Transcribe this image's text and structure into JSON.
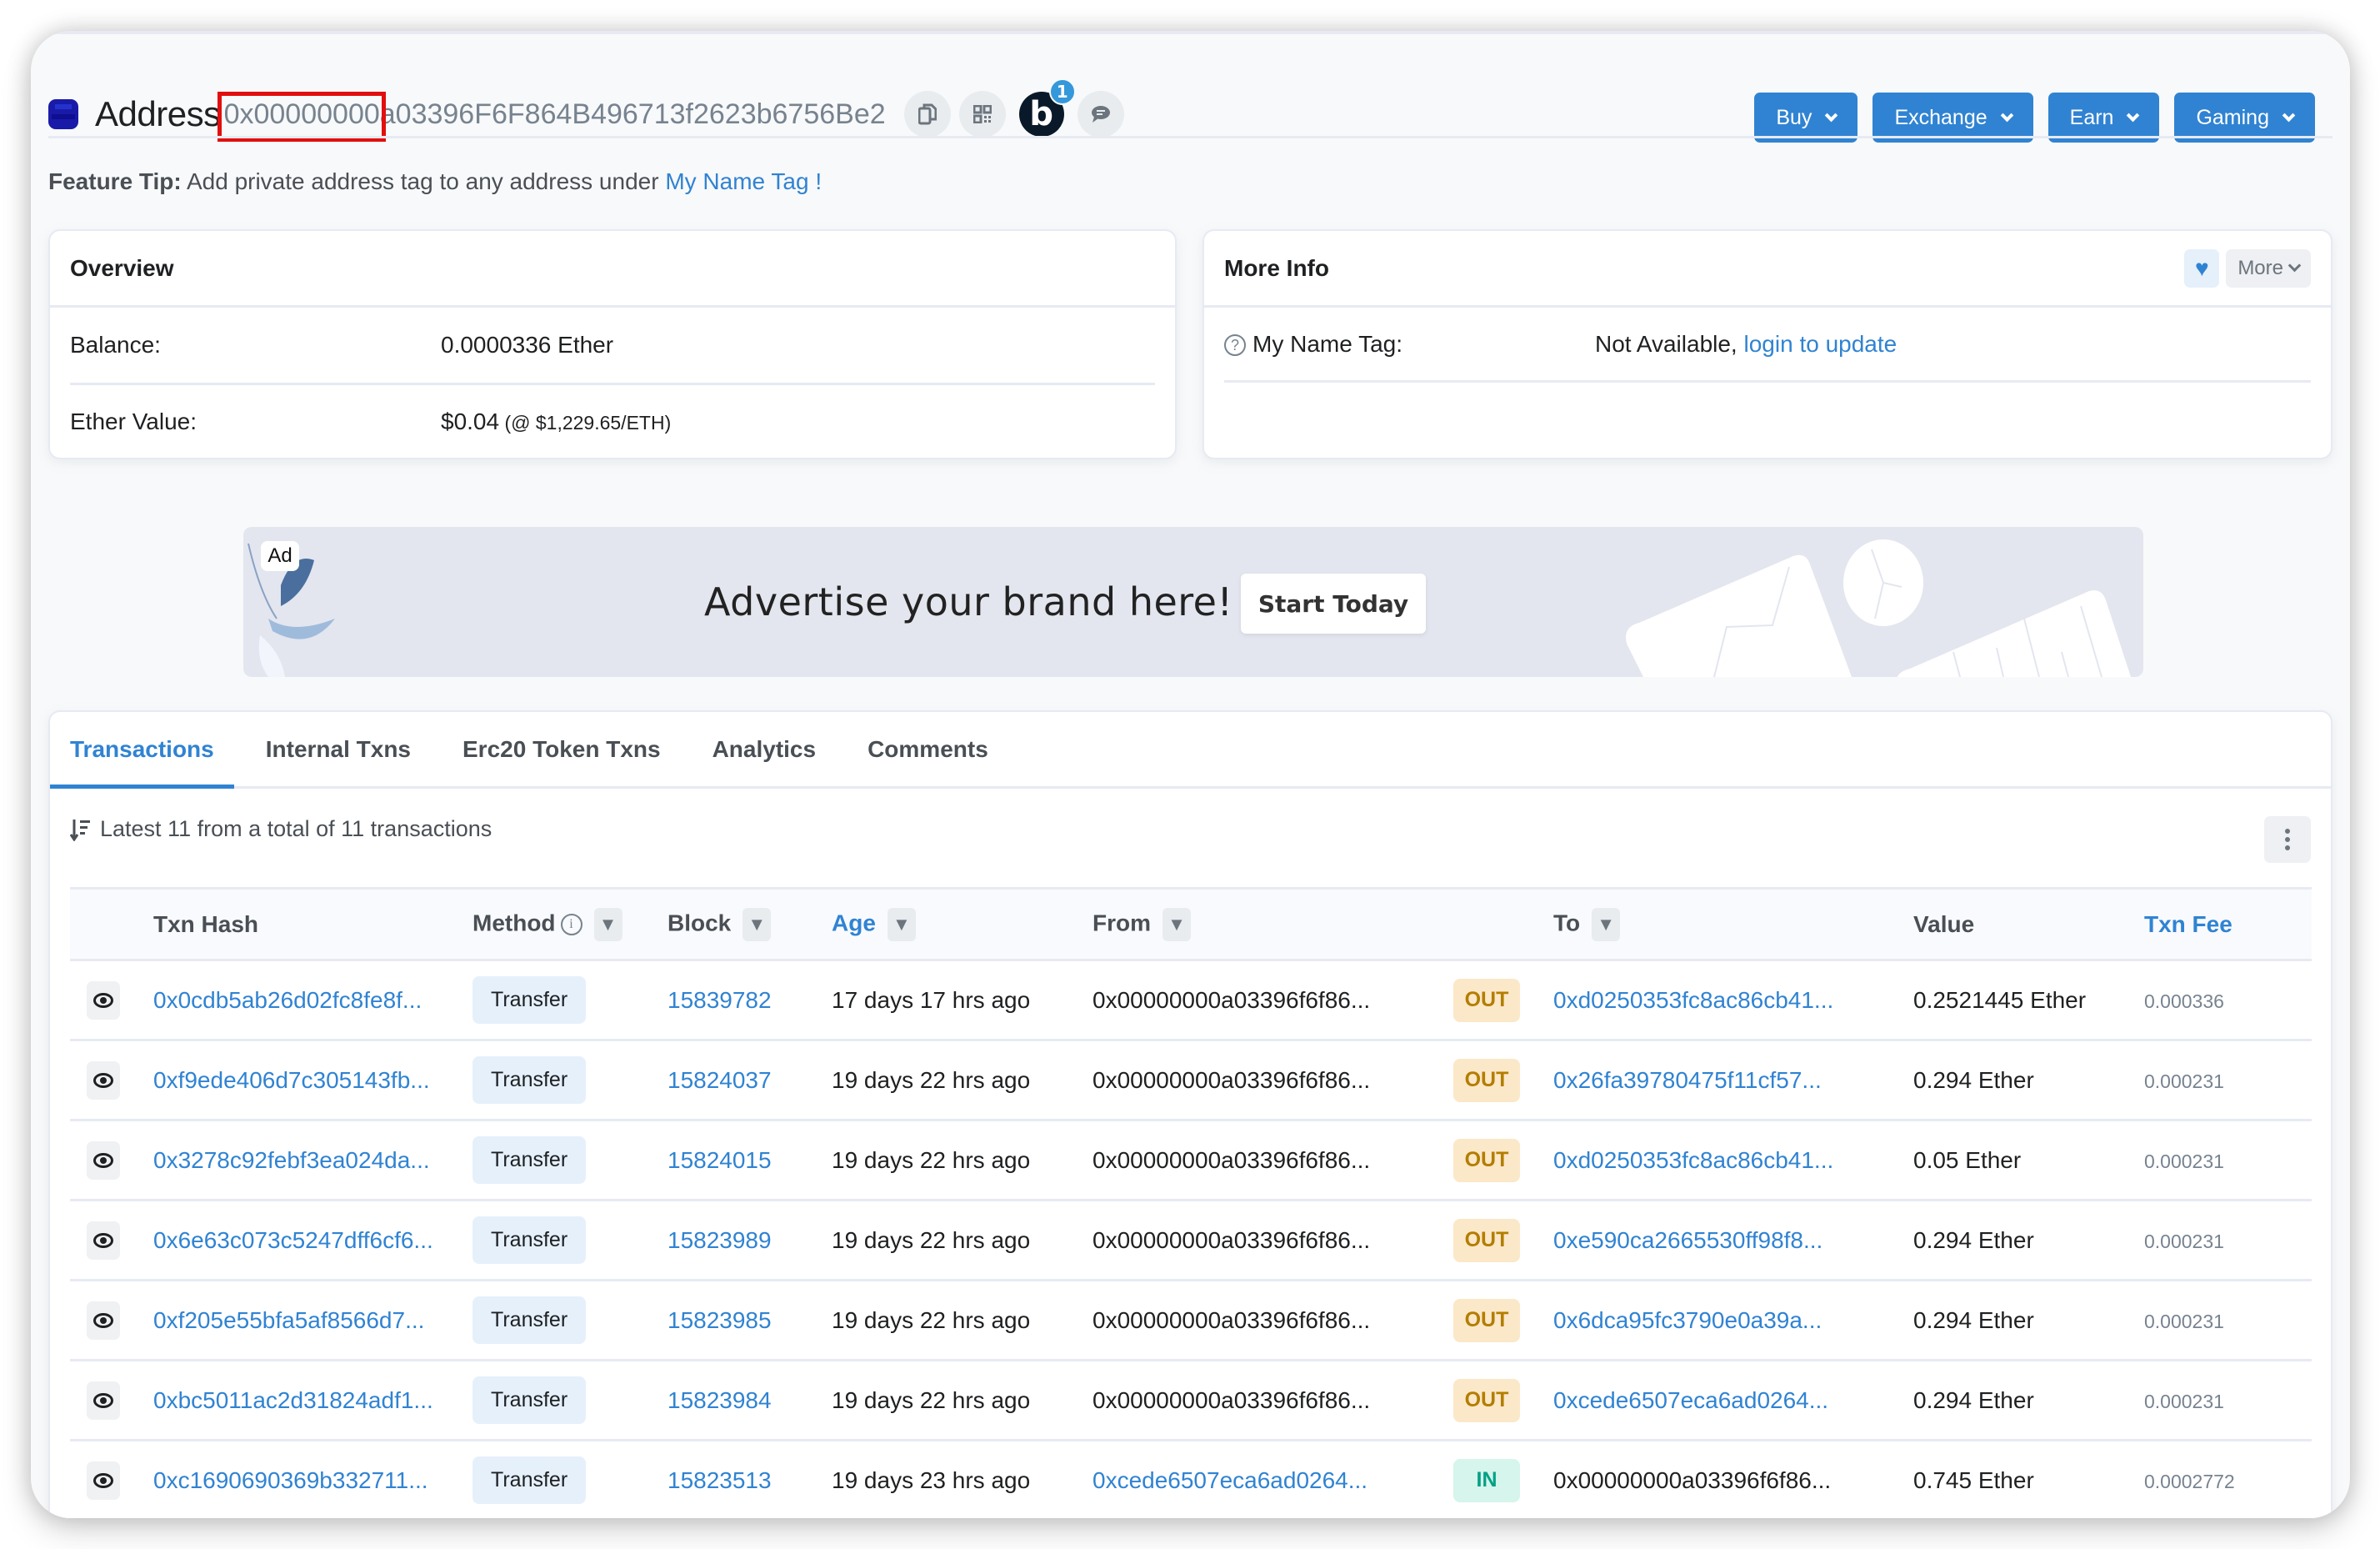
{
  "header": {
    "label": "Address",
    "address": "0x00000000a03396F6F864B496713f2623b6756Be2",
    "notification_count": "1",
    "b_label": "b",
    "nav_buttons": [
      "Buy",
      "Exchange",
      "Earn",
      "Gaming"
    ]
  },
  "feature_tip": {
    "prefix": "Feature Tip:",
    "text": " Add private address tag to any address under ",
    "link": "My Name Tag !"
  },
  "overview": {
    "title": "Overview",
    "balance_label": "Balance:",
    "balance_value": "0.0000336 Ether",
    "ether_value_label": "Ether Value:",
    "ether_value": "$0.04",
    "ether_price": " (@ $1,229.65/ETH)"
  },
  "more_info": {
    "title": "More Info",
    "more_label": "More",
    "name_tag_label": "My Name Tag:",
    "name_tag_value": "Not Available, ",
    "name_tag_link": "login to update"
  },
  "ad": {
    "tag": "Ad",
    "headline": "Advertise your brand here!",
    "cta": "Start Today"
  },
  "tabs": [
    "Transactions",
    "Internal Txns",
    "Erc20 Token Txns",
    "Analytics",
    "Comments"
  ],
  "active_tab": "Transactions",
  "summary": "Latest 11 from a total of 11 transactions",
  "table": {
    "headers": {
      "txn_hash": "Txn Hash",
      "method": "Method",
      "block": "Block",
      "age": "Age",
      "from": "From",
      "to": "To",
      "value": "Value",
      "fee": "Txn Fee"
    },
    "rows": [
      {
        "hash": "0x0cdb5ab26d02fc8fe8f...",
        "method": "Transfer",
        "block": "15839782",
        "age": "17 days 17 hrs ago",
        "from": "0x00000000a03396f6f86...",
        "dir": "OUT",
        "to": "0xd0250353fc8ac86cb41...",
        "value": "0.2521445 Ether",
        "fee": "0.000336"
      },
      {
        "hash": "0xf9ede406d7c305143fb...",
        "method": "Transfer",
        "block": "15824037",
        "age": "19 days 22 hrs ago",
        "from": "0x00000000a03396f6f86...",
        "dir": "OUT",
        "to": "0x26fa39780475f11cf57...",
        "value": "0.294 Ether",
        "fee": "0.000231"
      },
      {
        "hash": "0x3278c92febf3ea024da...",
        "method": "Transfer",
        "block": "15824015",
        "age": "19 days 22 hrs ago",
        "from": "0x00000000a03396f6f86...",
        "dir": "OUT",
        "to": "0xd0250353fc8ac86cb41...",
        "value": "0.05 Ether",
        "fee": "0.000231"
      },
      {
        "hash": "0x6e63c073c5247dff6cf6...",
        "method": "Transfer",
        "block": "15823989",
        "age": "19 days 22 hrs ago",
        "from": "0x00000000a03396f6f86...",
        "dir": "OUT",
        "to": "0xe590ca2665530ff98f8...",
        "value": "0.294 Ether",
        "fee": "0.000231"
      },
      {
        "hash": "0xf205e55bfa5af8566d7...",
        "method": "Transfer",
        "block": "15823985",
        "age": "19 days 22 hrs ago",
        "from": "0x00000000a03396f6f86...",
        "dir": "OUT",
        "to": "0x6dca95fc3790e0a39a...",
        "value": "0.294 Ether",
        "fee": "0.000231"
      },
      {
        "hash": "0xbc5011ac2d31824adf1...",
        "method": "Transfer",
        "block": "15823984",
        "age": "19 days 22 hrs ago",
        "from": "0x00000000a03396f6f86...",
        "dir": "OUT",
        "to": "0xcede6507eca6ad0264...",
        "value": "0.294 Ether",
        "fee": "0.000231"
      },
      {
        "hash": "0xc1690690369b332711...",
        "method": "Transfer",
        "block": "15823513",
        "age": "19 days 23 hrs ago",
        "from": "0xcede6507eca6ad0264...",
        "dir": "IN",
        "to": "0x00000000a03396f6f86...",
        "value": "0.745 Ether",
        "fee": "0.0002772"
      }
    ]
  },
  "colors": {
    "accent": "#3083d2",
    "out_badge_bg": "#fbe8c8",
    "out_badge_text": "#b47d00",
    "in_badge_bg": "#d6f5ec",
    "in_badge_text": "#00a186",
    "highlight_box": "#e10f0f"
  }
}
